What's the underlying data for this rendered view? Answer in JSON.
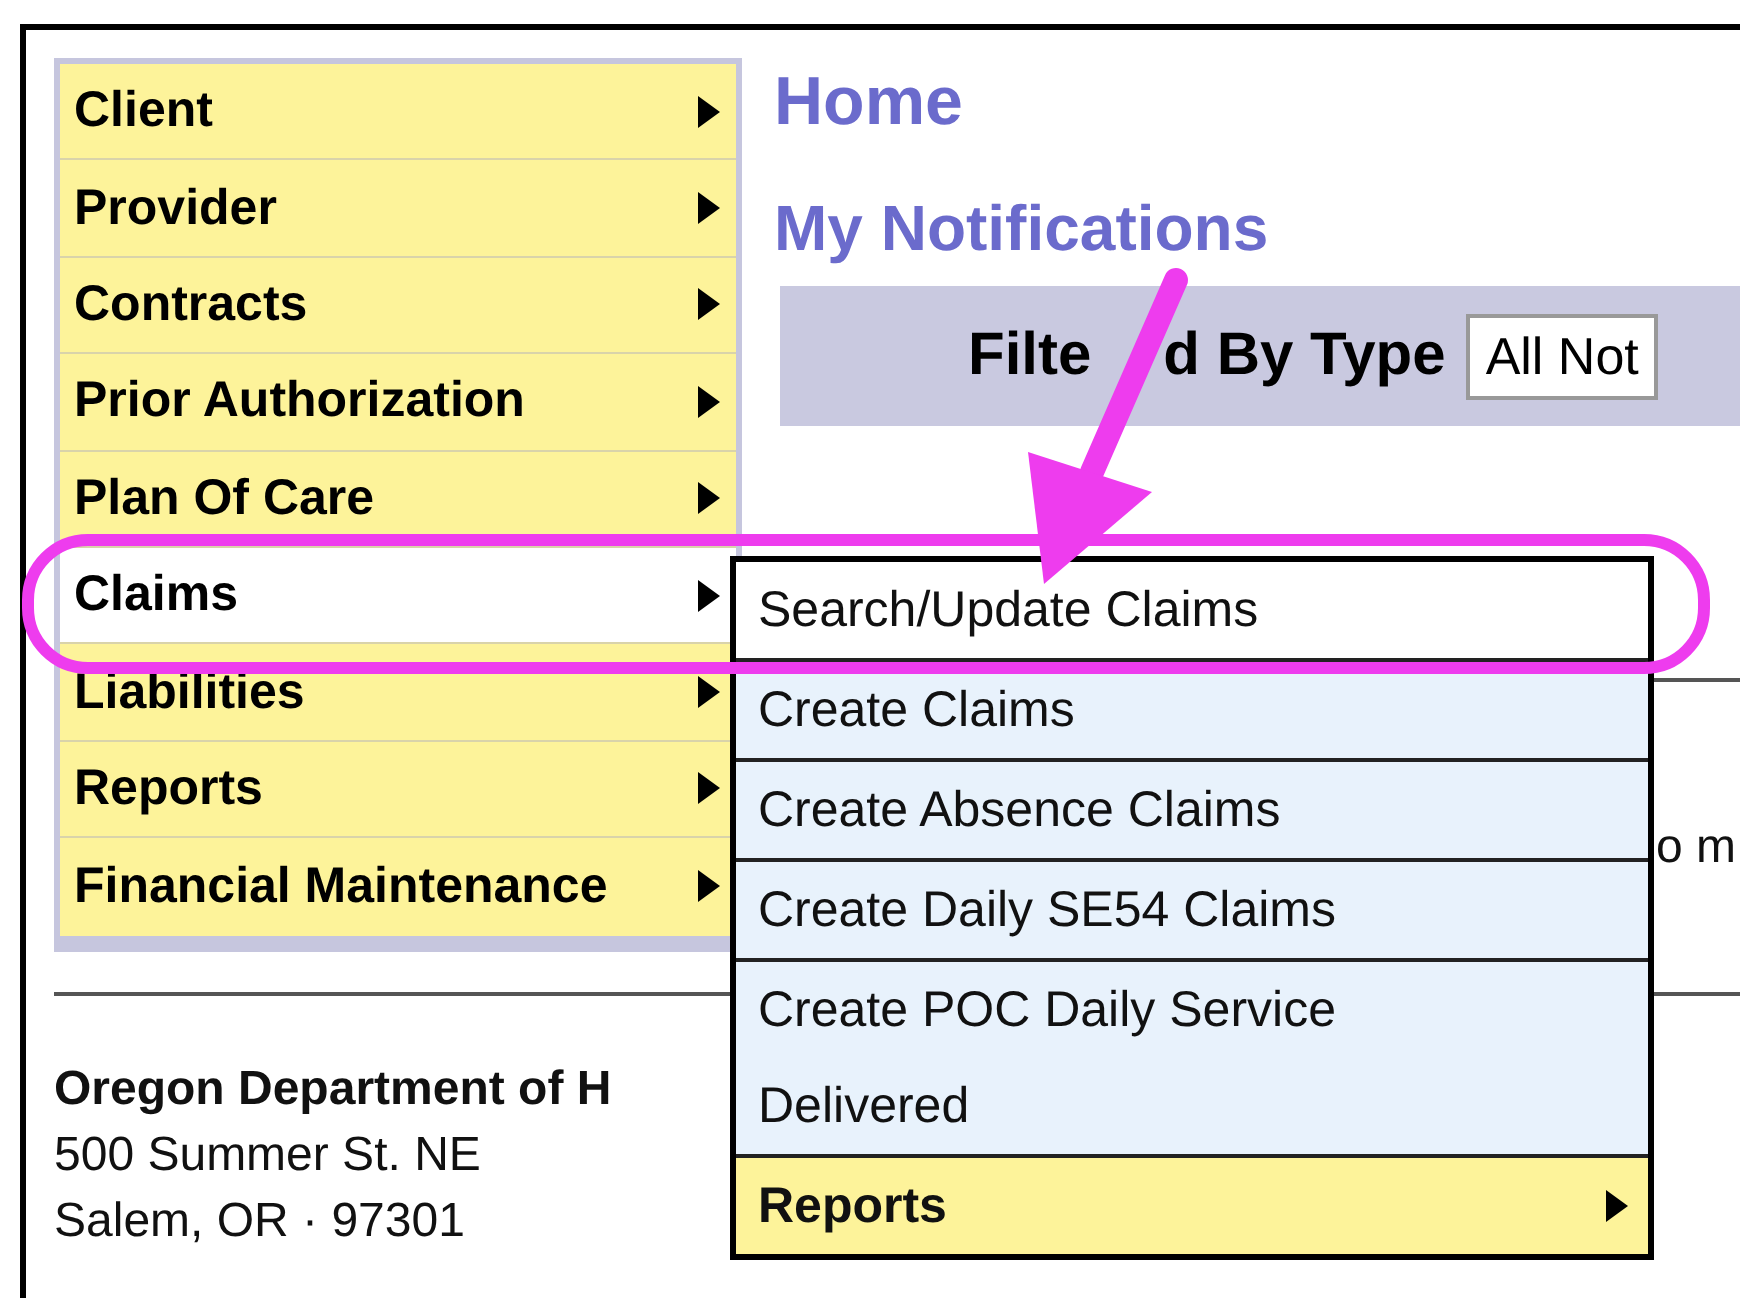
{
  "menu": [
    {
      "label": "Client",
      "selected": false
    },
    {
      "label": "Provider",
      "selected": false
    },
    {
      "label": "Contracts",
      "selected": false
    },
    {
      "label": "Prior Authorization",
      "selected": false
    },
    {
      "label": "Plan Of Care",
      "selected": false
    },
    {
      "label": "Claims",
      "selected": true
    },
    {
      "label": "Liabilities",
      "selected": false
    },
    {
      "label": "Reports",
      "selected": false
    },
    {
      "label": "Financial Maintenance",
      "selected": false
    }
  ],
  "heading": "Home",
  "subheading": "My Notifications",
  "filter": {
    "label_start": "Filte",
    "label_end": "d By Type",
    "value": "All Not"
  },
  "partial_text": "o m",
  "submenu": [
    {
      "label": "Search/Update Claims",
      "kind": "link",
      "selected": true
    },
    {
      "label": "Create Claims",
      "kind": "link",
      "selected": false
    },
    {
      "label": "Create Absence Claims",
      "kind": "link",
      "selected": false
    },
    {
      "label": "Create Daily SE54 Claims",
      "kind": "link",
      "selected": false
    },
    {
      "label": "Create POC Daily Service Delivered",
      "kind": "link",
      "selected": false
    },
    {
      "label": "Reports",
      "kind": "submenu",
      "selected": false
    }
  ],
  "footer": {
    "org": "Oregon Department of H",
    "address": "500 Summer St. NE",
    "city": "Salem, OR · 97301"
  }
}
